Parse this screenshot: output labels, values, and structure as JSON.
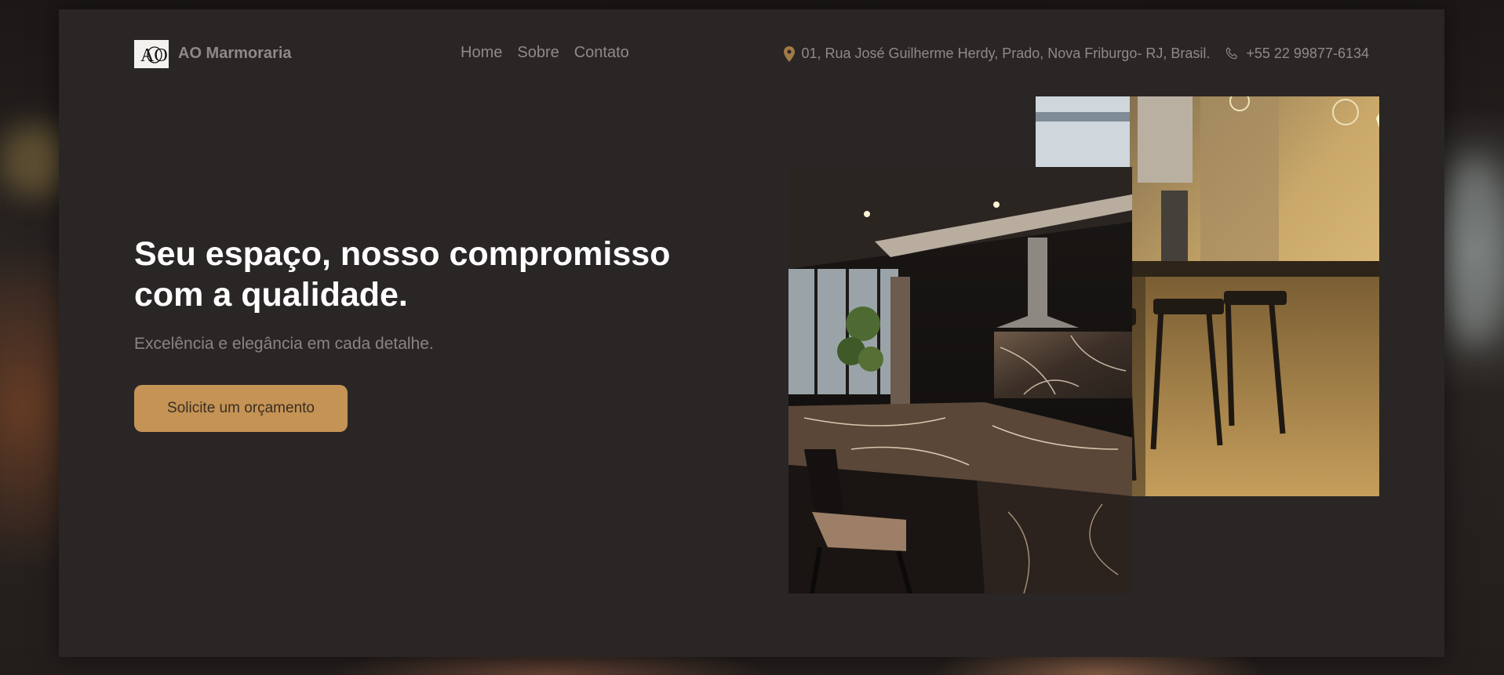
{
  "brand": {
    "logo_text": "AO",
    "name": "AO Marmoraria",
    "accent_color": "#c49355"
  },
  "nav": {
    "items": [
      {
        "label": "Home"
      },
      {
        "label": "Sobre"
      },
      {
        "label": "Contato"
      }
    ]
  },
  "contact": {
    "address_icon": "map-pin-icon",
    "address": "01, Rua José Guilherme Herdy, Prado, Nova Friburgo- RJ, Brasil.",
    "phone_icon": "phone-icon",
    "phone": "+55 22 99877-6134"
  },
  "hero": {
    "title": "Seu espaço, nosso compromisso com a qualidade.",
    "subtitle": "Excelência e elegância em cada detalhe.",
    "cta_label": "Solicite um orçamento"
  },
  "images": {
    "front": "dark-marble-kitchen-photo",
    "back": "kitchen-bar-stools-photo"
  }
}
